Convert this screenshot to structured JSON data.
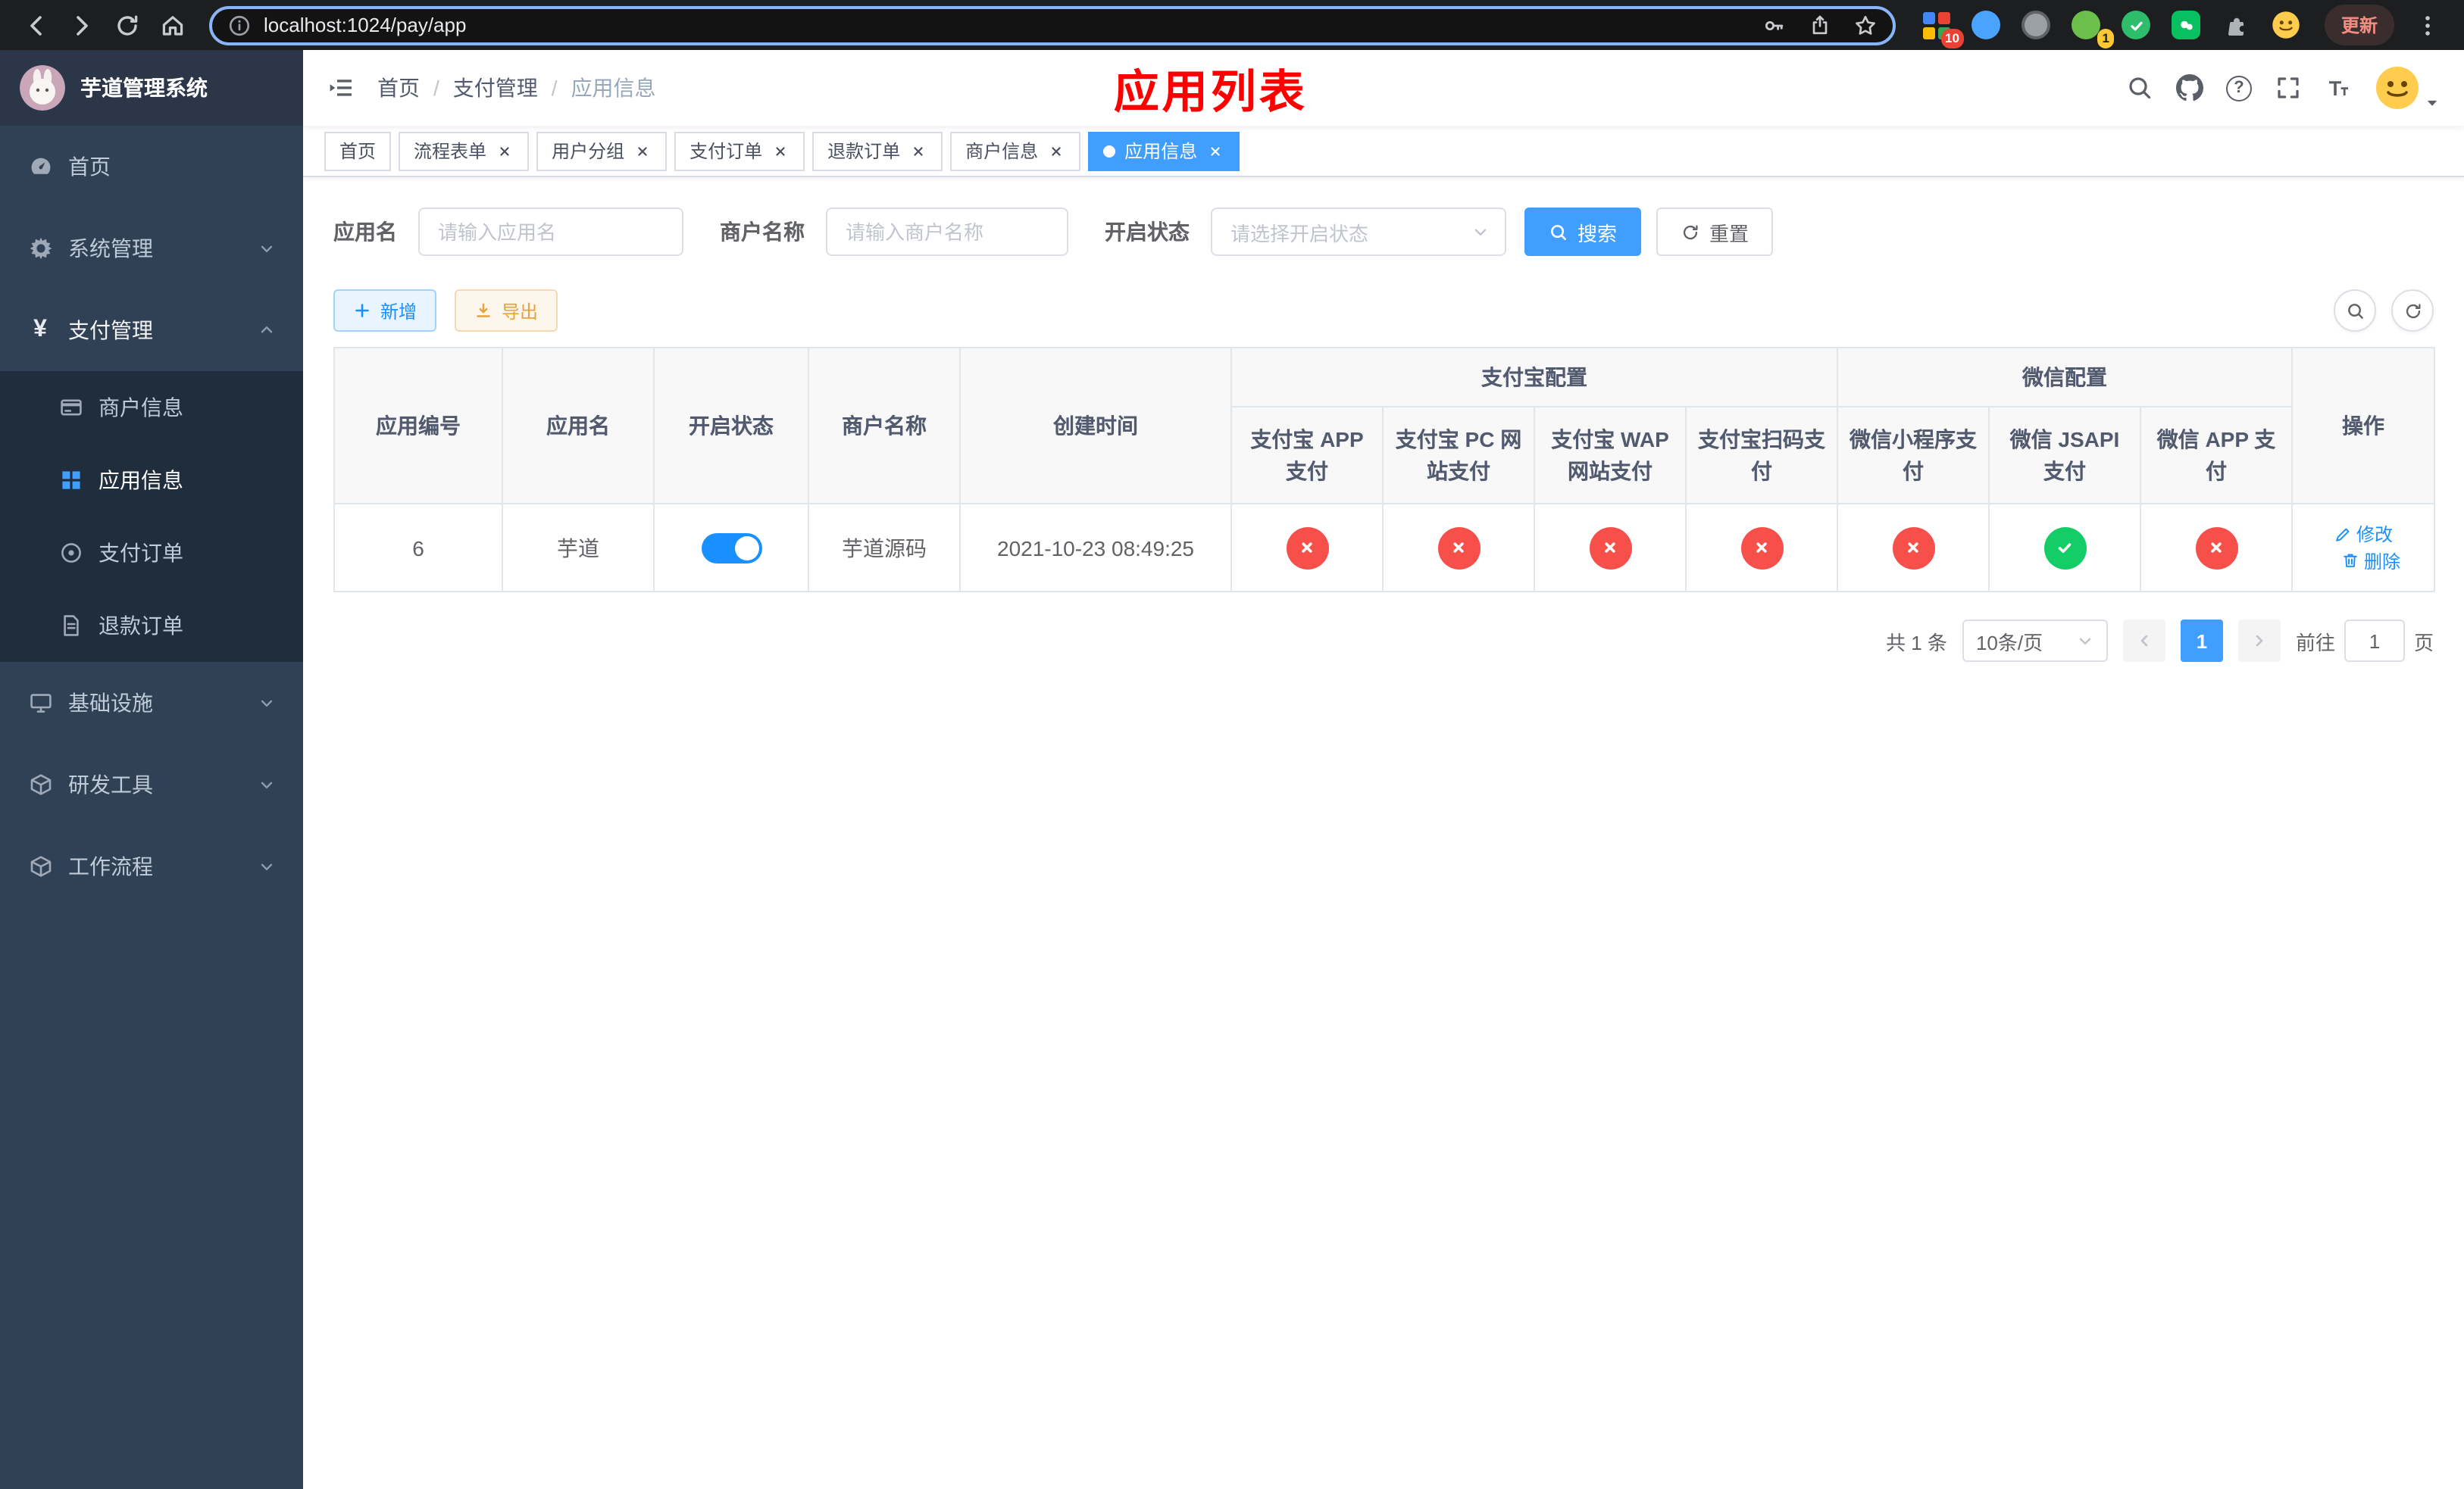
{
  "browser": {
    "url": "localhost:1024/pay/app",
    "update_label": "更新",
    "ext_badge_grid": "10",
    "ext_badge_avatar": "1"
  },
  "app": {
    "title": "芋道管理系统",
    "heading": "应用列表"
  },
  "icons": {
    "yen": "¥",
    "help": "?"
  },
  "sidebar": {
    "home": "首页",
    "system": "系统管理",
    "payment": "支付管理",
    "merchant_info": "商户信息",
    "app_info": "应用信息",
    "pay_order": "支付订单",
    "refund_order": "退款订单",
    "infra": "基础设施",
    "devtool": "研发工具",
    "workflow": "工作流程"
  },
  "breadcrumb": {
    "items": [
      "首页",
      "支付管理",
      "应用信息"
    ],
    "separator": "/"
  },
  "tabs": [
    {
      "label": "首页"
    },
    {
      "label": "流程表单"
    },
    {
      "label": "用户分组"
    },
    {
      "label": "支付订单"
    },
    {
      "label": "退款订单"
    },
    {
      "label": "商户信息"
    },
    {
      "label": "应用信息"
    }
  ],
  "filters": {
    "app_name_label": "应用名",
    "app_name_placeholder": "请输入应用名",
    "merchant_label": "商户名称",
    "merchant_placeholder": "请输入商户名称",
    "status_label": "开启状态",
    "status_placeholder": "请选择开启状态",
    "search": "搜索",
    "reset": "重置"
  },
  "toolbar": {
    "add": "新增",
    "export": "导出"
  },
  "table": {
    "group_alipay": "支付宝配置",
    "group_wechat": "微信配置",
    "col_id": "应用编号",
    "col_name": "应用名",
    "col_status": "开启状态",
    "col_merchant": "商户名称",
    "col_created": "创建时间",
    "col_alipay_app": "支付宝 APP 支付",
    "col_alipay_pc": "支付宝 PC 网站支付",
    "col_alipay_wap": "支付宝 WAP 网站支付",
    "col_alipay_qr": "支付宝扫码支付",
    "col_wx_mini": "微信小程序支付",
    "col_wx_jsapi": "微信 JSAPI 支付",
    "col_wx_app": "微信 APP 支付",
    "col_actions": "操作",
    "rows": [
      {
        "id": "6",
        "name": "芋道",
        "enabled": true,
        "merchant": "芋道源码",
        "created": "2021-10-23 08:49:25",
        "alipay_app": "fail",
        "alipay_pc": "fail",
        "alipay_wap": "fail",
        "alipay_qr": "fail",
        "wx_mini": "fail",
        "wx_jsapi": "ok",
        "wx_app": "fail",
        "edit": "修改",
        "delete": "删除"
      }
    ]
  },
  "pagination": {
    "total": "共 1 条",
    "size": "10条/页",
    "page": "1",
    "goto": "前往",
    "goto_value": "1",
    "unit": "页"
  },
  "colors": {
    "accent": "#409eff",
    "primary_button": "#1890ff",
    "success": "#13ce66",
    "danger": "#f7504a",
    "warning": "#e6a23c",
    "heading_red": "#ff0000",
    "sidebar_bg": "#304156",
    "submenu_bg": "#1f2d3d",
    "tab_active": "#409eff"
  }
}
